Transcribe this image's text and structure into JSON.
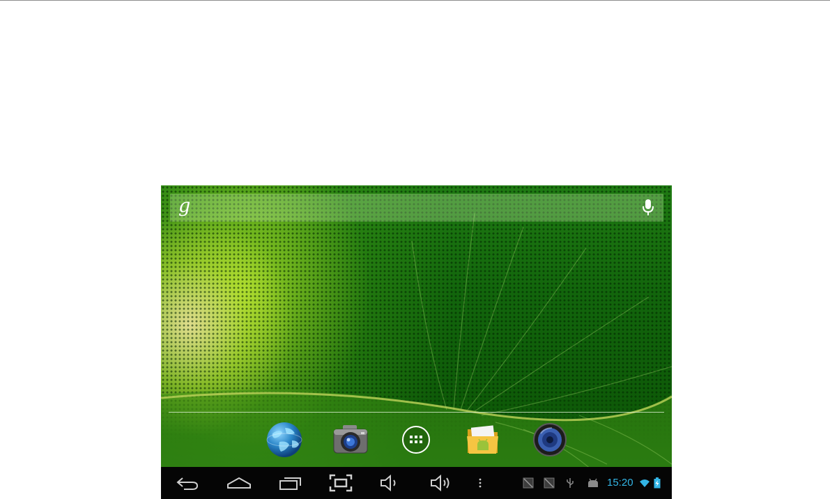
{
  "launcher": {
    "search_bar": {
      "logo_text": "g",
      "logo_icon": "google-g-icon",
      "voice_icon": "microphone-icon"
    },
    "dock": [
      {
        "name": "browser",
        "icon": "globe-icon"
      },
      {
        "name": "camera",
        "icon": "camera-icon"
      },
      {
        "name": "all-apps",
        "icon": "app-drawer-icon"
      },
      {
        "name": "file-manager",
        "icon": "folder-android-icon"
      },
      {
        "name": "music",
        "icon": "speaker-icon"
      }
    ]
  },
  "navbar": {
    "buttons": [
      {
        "name": "back",
        "icon": "back-arrow-icon"
      },
      {
        "name": "home",
        "icon": "home-icon"
      },
      {
        "name": "recent-apps",
        "icon": "recent-apps-icon"
      },
      {
        "name": "screenshot",
        "icon": "screenshot-icon"
      },
      {
        "name": "volume-down",
        "icon": "volume-down-icon"
      },
      {
        "name": "volume-up",
        "icon": "volume-up-icon"
      },
      {
        "name": "menu",
        "icon": "overflow-menu-icon"
      }
    ],
    "status": {
      "notification_icons": [
        "no-sim-icon",
        "no-sim-icon",
        "usb-icon",
        "android-debug-icon"
      ],
      "time": "15:20",
      "wifi_icon": "wifi-icon",
      "battery_icon": "battery-charging-icon"
    }
  },
  "colors": {
    "nav_background": "#050505",
    "accent_blue": "#33b5e5",
    "wallpaper_green": "#12650c"
  }
}
